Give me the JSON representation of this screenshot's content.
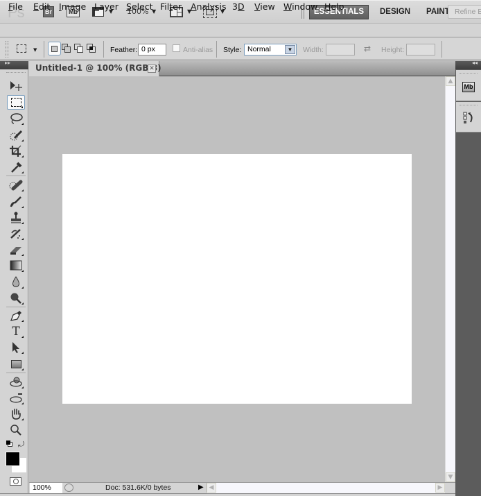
{
  "app": {
    "logo": "Ps",
    "bridge_label": "Br",
    "minibridge_label": "Mb",
    "zoom_level": "100%",
    "workspaces": [
      {
        "label": "ESSENTIALS",
        "active": true
      },
      {
        "label": "DESIGN",
        "active": false
      },
      {
        "label": "PAINTING",
        "active": false
      }
    ]
  },
  "menu": [
    {
      "label": "File",
      "mnemonic": "F",
      "rest": "ile"
    },
    {
      "label": "Edit",
      "mnemonic": "E",
      "rest": "dit"
    },
    {
      "label": "Image",
      "mnemonic": "I",
      "rest": "mage"
    },
    {
      "label": "Layer",
      "mnemonic": "L",
      "rest": "ayer"
    },
    {
      "label": "Select",
      "mnemonic": "S",
      "rest": "elect"
    },
    {
      "label": "Filter",
      "pre": "Fil",
      "mnemonic": "t",
      "rest": "er"
    },
    {
      "label": "Analysis",
      "mnemonic": "A",
      "rest": "nalysis"
    },
    {
      "label": "3D",
      "pre": "3",
      "mnemonic": "D",
      "rest": ""
    },
    {
      "label": "View",
      "mnemonic": "V",
      "rest": "iew"
    },
    {
      "label": "Window",
      "mnemonic": "W",
      "rest": "indow"
    },
    {
      "label": "Help",
      "mnemonic": "H",
      "rest": "elp"
    }
  ],
  "options": {
    "feather_label": "Feather:",
    "feather_value": "0 px",
    "antialias_label": "Anti-alias",
    "antialias_checked": false,
    "style_label": "Style:",
    "style_value": "Normal",
    "width_label": "Width:",
    "width_value": "",
    "height_label": "Height:",
    "height_value": "",
    "refine_label": "Refine Edge..."
  },
  "document": {
    "tab_title": "Untitled-1 @ 100% (RGB/8)",
    "close_glyph": "✕"
  },
  "tools": [
    {
      "name": "move-tool",
      "glyph": "move"
    },
    {
      "name": "rectangular-marquee-tool",
      "glyph": "marquee",
      "selected": true
    },
    {
      "name": "lasso-tool",
      "glyph": "lasso"
    },
    {
      "name": "quick-selection-tool",
      "glyph": "quicksel"
    },
    {
      "name": "crop-tool",
      "glyph": "crop"
    },
    {
      "name": "eyedropper-tool",
      "glyph": "eyedropper"
    },
    {
      "name": "spot-healing-brush-tool",
      "glyph": "heal"
    },
    {
      "name": "brush-tool",
      "glyph": "brush"
    },
    {
      "name": "clone-stamp-tool",
      "glyph": "stamp"
    },
    {
      "name": "history-brush-tool",
      "glyph": "historybrush"
    },
    {
      "name": "eraser-tool",
      "glyph": "eraser"
    },
    {
      "name": "gradient-tool",
      "glyph": "gradient"
    },
    {
      "name": "blur-tool",
      "glyph": "blur"
    },
    {
      "name": "dodge-tool",
      "glyph": "dodge"
    },
    {
      "name": "pen-tool",
      "glyph": "pen"
    },
    {
      "name": "type-tool",
      "glyph": "type",
      "text": "T"
    },
    {
      "name": "path-selection-tool",
      "glyph": "pathsel"
    },
    {
      "name": "rectangle-tool",
      "glyph": "rect"
    },
    {
      "name": "3d-rotate-tool",
      "glyph": "rotate3d"
    },
    {
      "name": "3d-orbit-tool",
      "glyph": "orbit3d"
    },
    {
      "name": "hand-tool",
      "glyph": "hand"
    },
    {
      "name": "zoom-tool",
      "glyph": "zoom"
    }
  ],
  "colors": {
    "foreground": "#000000",
    "background": "#ffffff",
    "canvas": "#ffffff",
    "pasteboard": "#c0c0c0",
    "workspace_active": "#6b6b6b"
  },
  "status": {
    "zoom": "100%",
    "doc_info": "Doc: 531.6K/0 bytes"
  },
  "right_dock": {
    "panels": [
      "mini-bridge",
      "history"
    ],
    "minibridge_label": "Mb"
  }
}
